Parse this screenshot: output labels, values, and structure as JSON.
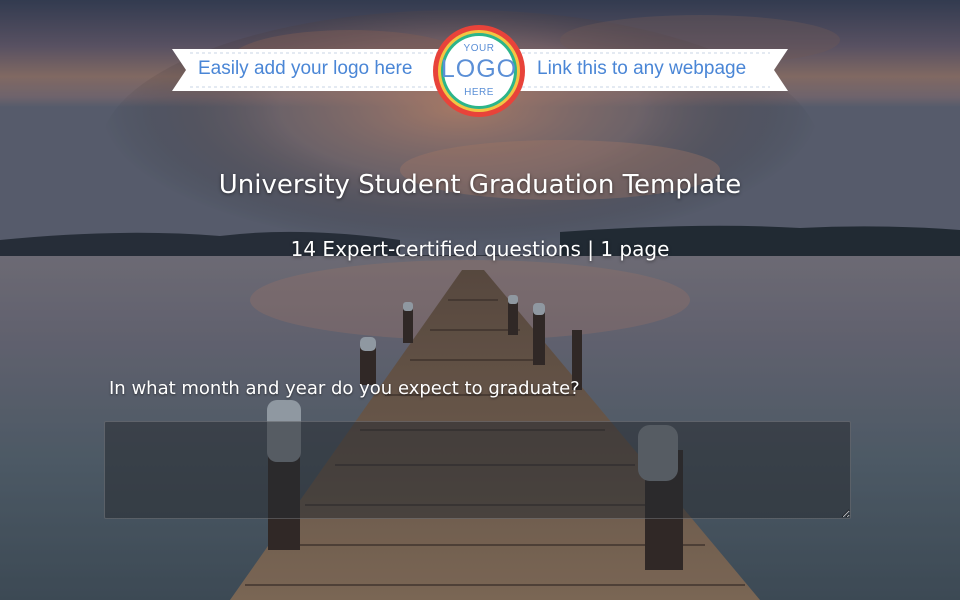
{
  "logo_banner": {
    "left_text": "Easily add your logo here",
    "right_text": "Link this to any webpage",
    "badge_top": "YOUR",
    "badge_mid": "LOGO",
    "badge_bottom": "HERE"
  },
  "survey": {
    "title": "University Student Graduation Template",
    "subtitle": "14 Expert-certified questions | 1 page"
  },
  "question": {
    "label": "In what month and year do you expect to graduate?",
    "answer_value": "",
    "answer_placeholder": ""
  },
  "colors": {
    "ribbon_text": "#4a86d6",
    "badge_ring_outer": "#e8433a",
    "badge_ring_inner": "#2cb58a",
    "title_text": "#ffffff"
  }
}
